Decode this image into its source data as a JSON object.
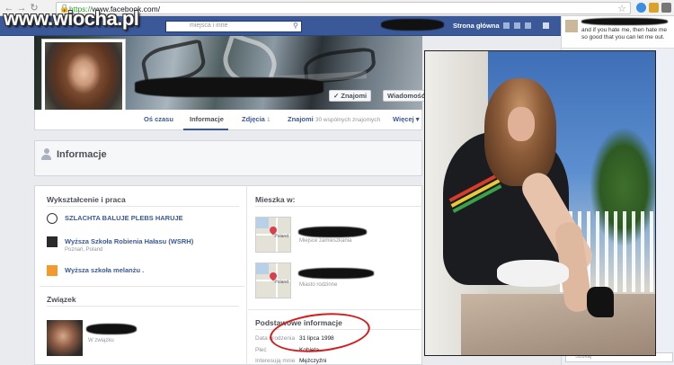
{
  "browser": {
    "url_scheme": "https://",
    "url_host": "www.facebook.com/"
  },
  "watermark": "www.wiocha.pl",
  "fb_header": {
    "search_placeholder": "miejsca i inne",
    "home_link": "Strona główna"
  },
  "ticker": {
    "text": "and if you hate me, then hate me so good that you can let me out."
  },
  "chat": {
    "search_placeholder": "Szukaj"
  },
  "cover": {
    "friends_button": "✓ Znajomi",
    "message_button": "Wiadomość"
  },
  "tabs": [
    {
      "label": "Oś czasu"
    },
    {
      "label": "Informacje"
    },
    {
      "label": "Zdjęcia",
      "count": "1"
    },
    {
      "label": "Znajomi",
      "sub": "30 wspólnych znajomych"
    },
    {
      "label": "Więcej ▾"
    }
  ],
  "section_title": "Informacje",
  "education": {
    "title": "Wykształcenie i praca",
    "items": [
      {
        "name": "SZLACHTA BALUJE PLEBS HARUJE",
        "sub": ""
      },
      {
        "name": "Wyższa Szkoła Robienia Hałasu (WSRH)",
        "sub": "Poznań, Poland"
      },
      {
        "name": "Wyższa szkoła melanżu .",
        "sub": ""
      }
    ]
  },
  "relationship": {
    "title": "Związek",
    "status": "W związku"
  },
  "lives": {
    "title": "Mieszka w:",
    "items": [
      {
        "sub": "Miejsce zamieszkania",
        "map_label": "Poland"
      },
      {
        "sub": "Miasto rodzinne",
        "map_label": "Poland"
      }
    ]
  },
  "basic_info": {
    "title": "Podstawowe informacje",
    "fields": [
      {
        "label": "Data urodzenia",
        "value": "31 lipca 1998"
      },
      {
        "label": "Płeć",
        "value": "Kobieta"
      },
      {
        "label": "Interesują mnie",
        "value": "Mężczyźni"
      }
    ]
  },
  "colors": {
    "fb_blue": "#3b5998",
    "highlight_red": "#d81a1a"
  }
}
